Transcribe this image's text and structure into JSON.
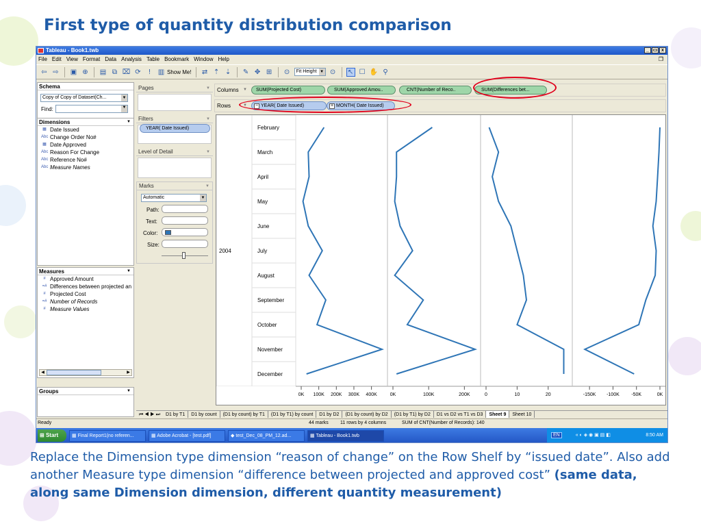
{
  "slide": {
    "title": "First type of quantity distribution comparison",
    "caption_plain": "Replace the Dimension type dimension “reason of change” on the Row Shelf by “issued date”. Also add another Measure type dimension “difference between projected and approved cost”",
    "caption_bold": "(same data, along same Dimension dimension, different quantity measurement)"
  },
  "window": {
    "title": "Tableau - Book1.twb",
    "buttons": [
      "_",
      "а",
      "x"
    ]
  },
  "menu": [
    "File",
    "Edit",
    "View",
    "Format",
    "Data",
    "Analysis",
    "Table",
    "Bookmark",
    "Window",
    "Help"
  ],
  "toolbar": {
    "show_me": "Show Me!",
    "fit": "Fit Height"
  },
  "schema": {
    "header": "Schema",
    "datasource": "Copy of Copy of Dataset(Ch...",
    "find_label": "Find:"
  },
  "dimensions": {
    "header": "Dimensions",
    "items": [
      {
        "icon": "date-icon",
        "label": "Date Issued"
      },
      {
        "icon": "abc-icon",
        "label": "Change Order No#"
      },
      {
        "icon": "date-icon",
        "label": "Date Approved"
      },
      {
        "icon": "abc-icon",
        "label": "Reason For Change"
      },
      {
        "icon": "abc-icon",
        "label": "Reference No#"
      },
      {
        "icon": "abc-icon",
        "label": "Measure Names"
      }
    ]
  },
  "measures": {
    "header": "Measures",
    "items": [
      {
        "icon": "#",
        "label": "Approved Amount"
      },
      {
        "icon": "=#",
        "label": "Differences between projected an"
      },
      {
        "icon": "#",
        "label": "Projected Cost"
      },
      {
        "icon": "=#",
        "label": "Number of Records"
      },
      {
        "icon": "#",
        "label": "Measure Values"
      }
    ]
  },
  "groups": {
    "header": "Groups"
  },
  "cards": {
    "pages": "Pages",
    "filters": "Filters",
    "filter_pill": "YEAR( Date  Issued)",
    "lod": "Level of Detail",
    "marks": "Marks",
    "marks_type": "Automatic",
    "path": "Path:",
    "text": "Text:",
    "color": "Color:",
    "size": "Size:",
    "color_swatch": "#2e75b6"
  },
  "shelves": {
    "columns_label": "Columns",
    "rows_label": "Rows",
    "columns": [
      "SUM(Projected Cost)",
      "SUM(Approved Amou..",
      "CNT(Number of Reco..",
      "SUM(Differences bet..."
    ],
    "rows": [
      "YEAR( Date  Issued)",
      "MONTH( Date  Issued)"
    ]
  },
  "tabs": [
    "D1 by T1",
    "D1 by count",
    "(D1 by count) by T1",
    "(D1 by T1) by count",
    "D1 by D2",
    "(D1 by count) by D2",
    "(D1 by T1) by D2",
    "D1 vs D2 vs T1 vs D3",
    "Sheet 9",
    "Sheet 10"
  ],
  "active_tab": "Sheet 9",
  "status": {
    "ready": "Ready",
    "marks": "44 marks",
    "dims": "11 rows by 4 columns",
    "sum": "SUM of CNT(Number of Records): 140"
  },
  "taskbar": {
    "start": "Start",
    "items": [
      "Final Report1(no referen...",
      "Adobe Acrobat - [test.pdf]",
      "test_Dec_08_PM_12.ad...",
      "Tableau - Book1.twb"
    ],
    "lang": "EN",
    "time": "8:50 AM"
  },
  "chart_data": {
    "type": "line",
    "year": "2004",
    "categories": [
      "February",
      "March",
      "April",
      "May",
      "June",
      "July",
      "August",
      "September",
      "October",
      "November",
      "December"
    ],
    "line_color": "#2e75b6",
    "panels": [
      {
        "name": "SUM(Projected Cost)",
        "ticks": [
          "0K",
          "100K",
          "200K",
          "300K",
          "400K"
        ],
        "tick_values": [
          0,
          100000,
          200000,
          300000,
          400000
        ],
        "xlim": [
          0,
          460000
        ],
        "values": [
          130000,
          40000,
          45000,
          10000,
          40000,
          120000,
          45000,
          140000,
          90000,
          460000,
          30000
        ]
      },
      {
        "name": "SUM(Approved Amount)",
        "ticks": [
          "0K",
          "100K",
          "200K"
        ],
        "tick_values": [
          0,
          100000,
          200000
        ],
        "xlim": [
          0,
          230000
        ],
        "values": [
          110000,
          10000,
          10000,
          5000,
          20000,
          55000,
          5000,
          85000,
          40000,
          230000,
          10000
        ]
      },
      {
        "name": "CNT(Number of Records)",
        "ticks": [
          "0",
          "10",
          "20"
        ],
        "tick_values": [
          0,
          10,
          20
        ],
        "xlim": [
          0,
          26
        ],
        "values": [
          1,
          4,
          2,
          4,
          8,
          10,
          12,
          13,
          10,
          25,
          25
        ]
      },
      {
        "name": "SUM(Differences between projected and approved cost)",
        "ticks": [
          "-150K",
          "-100K",
          "-50K",
          "0K"
        ],
        "tick_values": [
          -150000,
          -100000,
          -50000,
          0
        ],
        "xlim": [
          -175000,
          0
        ],
        "values": [
          0,
          -2000,
          -5000,
          -8000,
          -15000,
          -8000,
          -10000,
          -30000,
          -45000,
          -160000,
          -55000
        ]
      }
    ]
  }
}
